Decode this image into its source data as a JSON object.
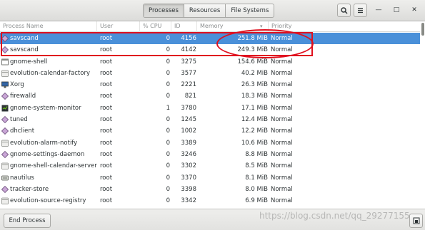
{
  "header": {
    "tabs": [
      {
        "label": "Processes",
        "active": true
      },
      {
        "label": "Resources",
        "active": false
      },
      {
        "label": "File Systems",
        "active": false
      }
    ],
    "search_icon": "search-icon",
    "menu_icon": "hamburger-menu-icon",
    "window_controls": {
      "minimize": "—",
      "maximize": "□",
      "close": "✕"
    }
  },
  "columns": {
    "name": "Process Name",
    "user": "User",
    "cpu": "% CPU",
    "id": "ID",
    "memory": "Memory",
    "priority": "Priority"
  },
  "rows": [
    {
      "icon": "script-icon",
      "name": "savscand",
      "user": "root",
      "cpu": "0",
      "id": "4156",
      "memory": "251.8 MiB",
      "priority": "Normal",
      "selected": true
    },
    {
      "icon": "script-icon",
      "name": "savscand",
      "user": "root",
      "cpu": "0",
      "id": "4142",
      "memory": "249.3 MiB",
      "priority": "Normal"
    },
    {
      "icon": "window-icon",
      "name": "gnome-shell",
      "user": "root",
      "cpu": "0",
      "id": "3275",
      "memory": "154.6 MiB",
      "priority": "Normal"
    },
    {
      "icon": "calendar-icon",
      "name": "evolution-calendar-factory",
      "user": "root",
      "cpu": "0",
      "id": "3577",
      "memory": "40.2 MiB",
      "priority": "Normal"
    },
    {
      "icon": "monitor-icon",
      "name": "Xorg",
      "user": "root",
      "cpu": "0",
      "id": "2221",
      "memory": "26.3 MiB",
      "priority": "Normal"
    },
    {
      "icon": "script-icon",
      "name": "firewalld",
      "user": "root",
      "cpu": "0",
      "id": "821",
      "memory": "18.3 MiB",
      "priority": "Normal"
    },
    {
      "icon": "terminal-icon",
      "name": "gnome-system-monitor",
      "user": "root",
      "cpu": "1",
      "id": "3780",
      "memory": "17.1 MiB",
      "priority": "Normal"
    },
    {
      "icon": "script-icon",
      "name": "tuned",
      "user": "root",
      "cpu": "0",
      "id": "1245",
      "memory": "12.4 MiB",
      "priority": "Normal"
    },
    {
      "icon": "script-icon",
      "name": "dhclient",
      "user": "root",
      "cpu": "0",
      "id": "1002",
      "memory": "12.2 MiB",
      "priority": "Normal"
    },
    {
      "icon": "calendar-icon",
      "name": "evolution-alarm-notify",
      "user": "root",
      "cpu": "0",
      "id": "3389",
      "memory": "10.6 MiB",
      "priority": "Normal"
    },
    {
      "icon": "script-icon",
      "name": "gnome-settings-daemon",
      "user": "root",
      "cpu": "0",
      "id": "3246",
      "memory": "8.8 MiB",
      "priority": "Normal"
    },
    {
      "icon": "calendar-icon",
      "name": "gnome-shell-calendar-server",
      "user": "root",
      "cpu": "0",
      "id": "3302",
      "memory": "8.5 MiB",
      "priority": "Normal"
    },
    {
      "icon": "drive-icon",
      "name": "nautilus",
      "user": "root",
      "cpu": "0",
      "id": "3370",
      "memory": "8.1 MiB",
      "priority": "Normal"
    },
    {
      "icon": "script-icon",
      "name": "tracker-store",
      "user": "root",
      "cpu": "0",
      "id": "3398",
      "memory": "8.0 MiB",
      "priority": "Normal"
    },
    {
      "icon": "calendar-icon",
      "name": "evolution-source-registry",
      "user": "root",
      "cpu": "0",
      "id": "3342",
      "memory": "6.9 MiB",
      "priority": "Normal"
    }
  ],
  "footer": {
    "end_process_label": "End Process",
    "properties_icon": "properties-icon"
  },
  "watermark": "https://blog.csdn.net/qq_29277155",
  "colors": {
    "selection": "#4a90d9",
    "annotation_red": "#e0101e"
  }
}
